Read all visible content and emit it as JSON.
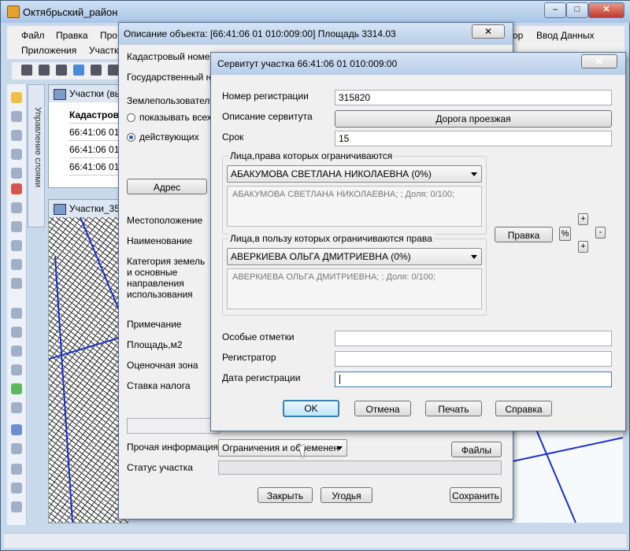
{
  "app": {
    "title": "Октябрьский_район"
  },
  "window_controls": {
    "minimize": "–",
    "maximize": "□",
    "close": "✕"
  },
  "menu": {
    "items": [
      "Файл",
      "Правка",
      "Про",
      "ор",
      "Ввод Данных"
    ],
    "items2": [
      "Приложения",
      "Участк"
    ]
  },
  "side_tab": {
    "label": "Управление слоями"
  },
  "parcels_window": {
    "title": "Участки (вы",
    "header": "Кадастров",
    "rows": [
      "66:41:06 01",
      "66:41:06 01",
      "66:41:06 01"
    ]
  },
  "map_window": {
    "title": "Участки_35"
  },
  "descr_dialog": {
    "title": "Описание объекта: [66:41:06 01 010:009:00]   Площадь 3314.03",
    "close": "✕",
    "fields": {
      "cadastral": "Кадастровый номер",
      "state": "Государственный но",
      "land_user": "Землепользовател",
      "radio_all": "показывать всех",
      "radio_active": "действующих",
      "address_btn": "Адрес",
      "location": "Местоположение",
      "name": "Наименование",
      "category": "Категория земель и основные направления использования",
      "note": "Примечание",
      "area": "Площадь,м2",
      "valuation_zone": "Оценочная зона",
      "tax_rate": "Ставка налога",
      "other_info": "Прочая информация",
      "other_info_value": "Ограничения и обременен",
      "files_btn": "Файлы",
      "status": "Статус участка"
    },
    "buttons": {
      "close": "Закрыть",
      "lands": "Угодья",
      "save": "Сохранить"
    }
  },
  "serv_dialog": {
    "title": "Сервитут участка 66:41:06 01 010:009:00",
    "close": "✕",
    "reg_number_label": "Номер регистрации",
    "reg_number": "315820",
    "description_label": "Описание сервитута",
    "description": "Дорога проезжая",
    "term_label": "Срок",
    "term": "15",
    "restricted_group": "Лица,права которых ограничиваются",
    "restricted_selected": "АБАКУМОВА СВЕТЛАНА НИКОЛАЕВНА       (0%)",
    "restricted_detail": "АБАКУМОВА СВЕТЛАНА НИКОЛАЕВНА; ; Доля: 0/100;",
    "beneficiary_group": "Лица,в пользу которых ограничиваются права",
    "beneficiary_selected": "АВЕРКИЕВА ОЛЬГА ДМИТРИЕВНА       (0%)",
    "beneficiary_detail": "АВЕРКИЕВА ОЛЬГА ДМИТРИЕВНА; ; Доля: 0/100;",
    "rights_btn": "Правка",
    "percent_btn": "%",
    "plus": "+",
    "minus": "-",
    "special_marks_label": "Особые отметки",
    "special_marks": "",
    "registrar_label": "Регистратор",
    "registrar": "",
    "reg_date_label": "Дата регистрации",
    "reg_date": "",
    "buttons": {
      "ok": "OK",
      "cancel": "Отмена",
      "print": "Печать",
      "help": "Справка"
    }
  }
}
